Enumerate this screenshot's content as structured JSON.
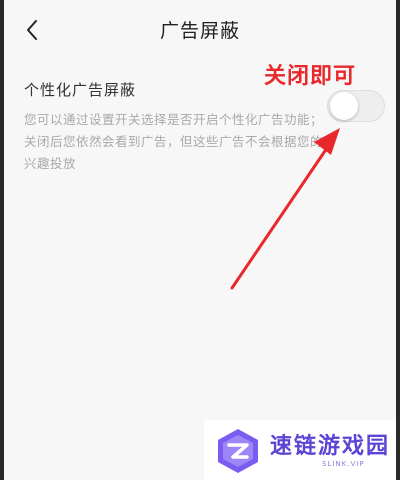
{
  "header": {
    "title": "广告屏蔽",
    "back_icon": "chevron-left-icon"
  },
  "setting": {
    "title": "个性化广告屏蔽",
    "description": "您可以通过设置开关选择是否开启个性化广告功能；关闭后您依然会看到广告，但这些广告不会根据您的兴趣投放",
    "toggle_on": false
  },
  "annotation": {
    "text": "关闭即可",
    "color": "#e8282a"
  },
  "watermark": {
    "name": "速链游戏园",
    "sub": "SLINK.VIP"
  },
  "colors": {
    "background": "#f7f7f7",
    "title_text": "#222222",
    "desc_text": "#a9a9a9",
    "accent_watermark": "#5b45d6"
  }
}
